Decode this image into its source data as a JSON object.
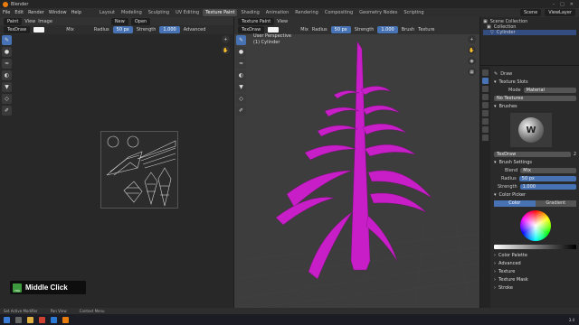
{
  "window": {
    "title": "Blender"
  },
  "menus": [
    "File",
    "Edit",
    "Render",
    "Window",
    "Help"
  ],
  "workspaces": [
    "Layout",
    "Modeling",
    "Sculpting",
    "UV Editing",
    "Texture Paint",
    "Shading",
    "Animation",
    "Rendering",
    "Compositing",
    "Geometry Nodes",
    "Scripting"
  ],
  "active_workspace": "Texture Paint",
  "scene": {
    "scene_label": "Scene",
    "layer_label": "ViewLayer"
  },
  "left_editor": {
    "mode": "Paint",
    "view_menu": "View",
    "image_menu": "Image",
    "new_button": "New",
    "open_button": "Open",
    "brush": "TexDraw",
    "blend": "Mix",
    "radius_label": "Radius",
    "radius_value": "50 px",
    "strength_label": "Strength",
    "strength_value": "1.000",
    "advanced": "Advanced"
  },
  "keycast": {
    "mouse_label": "TRK",
    "text": "Middle Click"
  },
  "viewport": {
    "mode": "Texture Paint",
    "view_menu": "View",
    "brush": "TexDraw",
    "blend": "Mix",
    "radius_label": "Radius",
    "radius_value": "50 px",
    "strength_label": "Strength",
    "strength_value": "1.000",
    "brush_menu": "Brush",
    "texture_menu": "Texture",
    "perspective": "User Perspective",
    "object": "(1) Cylinder"
  },
  "outliner": {
    "root": "Scene Collection",
    "collection": "Collection",
    "object": "Cylinder"
  },
  "properties": {
    "tool": "Draw",
    "texture_slots": "Texture Slots",
    "mode_label": "Mode",
    "mode_value": "Material",
    "no_textures": "No Textures",
    "brushes": "Brushes",
    "brush_name": "TexDraw",
    "brush_users": "2",
    "brush_settings": "Brush Settings",
    "blend_label": "Blend",
    "blend_value": "Mix",
    "radius_label": "Radius",
    "radius_value": "50 px",
    "strength_label": "Strength",
    "strength_value": "1.000",
    "color_picker": "Color Picker",
    "color_tab": "Color",
    "gradient_tab": "Gradient",
    "sections": [
      "Color Palette",
      "Advanced",
      "Texture",
      "Texture Mask",
      "Stroke"
    ]
  },
  "statusbar": [
    "Set Active Modifier",
    "Pan View",
    "Context Menu"
  ],
  "taskbar": {
    "tray": "3.4"
  },
  "colors": {
    "accent": "#4772b3",
    "mesh": "#c81ec8",
    "keycast_mouse": "#3d9a3d"
  }
}
